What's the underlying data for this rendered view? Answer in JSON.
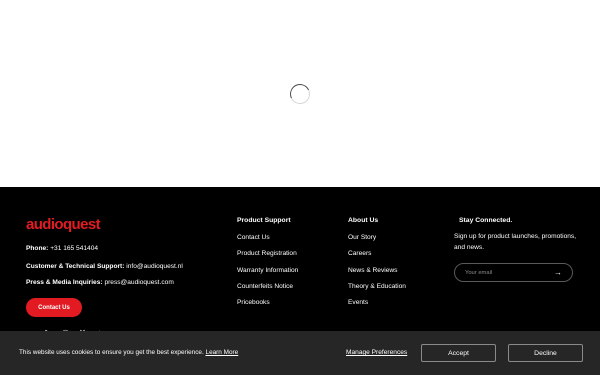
{
  "brand": {
    "logo_text": "audioquest",
    "accent_color": "#e21b23"
  },
  "footer": {
    "contact": {
      "phone_label": "Phone:",
      "phone_value": "+31 165 541404",
      "support_label": "Customer & Technical Support:",
      "support_value": "info@audioquest.nl",
      "press_label": "Press & Media Inquiries:",
      "press_value": "press@audioquest.com",
      "button_label": "Contact Us"
    },
    "social_icons": [
      "facebook-icon",
      "youtube-icon",
      "instagram-icon",
      "x-icon",
      "tiktok-icon"
    ],
    "product_support": {
      "title": "Product Support",
      "links": [
        "Contact Us",
        "Product Registration",
        "Warranty Information",
        "Counterfeits Notice",
        "Pricebooks"
      ]
    },
    "about_us": {
      "title": "About Us",
      "links": [
        "Our Story",
        "Careers",
        "News & Reviews",
        "Theory & Education",
        "Events"
      ]
    },
    "newsletter": {
      "title": "Stay Connected.",
      "text": "Sign up for product launches, promotions, and news.",
      "email_placeholder": "Your email",
      "submit_icon": "arrow-right-icon"
    }
  },
  "cookie_bar": {
    "text": "This website uses cookies to ensure you get the best experience.",
    "learn_more": "Learn More",
    "manage": "Manage Preferences",
    "accept": "Accept",
    "decline": "Decline"
  }
}
